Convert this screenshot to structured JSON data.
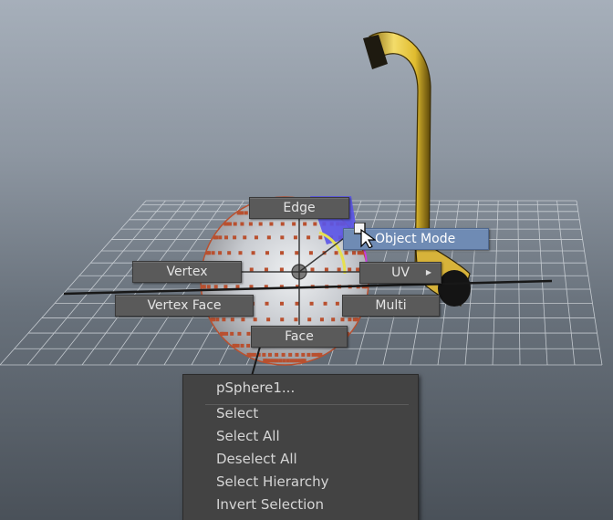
{
  "marking_menu": {
    "edge": "Edge",
    "vertex": "Vertex",
    "vertex_face": "Vertex Face",
    "face": "Face",
    "object_mode": "Object Mode",
    "uv": "UV",
    "multi": "Multi"
  },
  "context_menu": {
    "header": "pSphere1...",
    "items": [
      "Select",
      "Select All",
      "Deselect All",
      "Select Hierarchy",
      "Invert Selection"
    ]
  },
  "colors": {
    "viewport_top": "#a6afba",
    "viewport_bottom": "#4a5159",
    "highlight": "#6f8bb4",
    "menu_bg": "#434343",
    "button_bg": "#5a5a5a",
    "sphere_vertices": "#b9502f",
    "yellow_object": "#e2c23c"
  }
}
